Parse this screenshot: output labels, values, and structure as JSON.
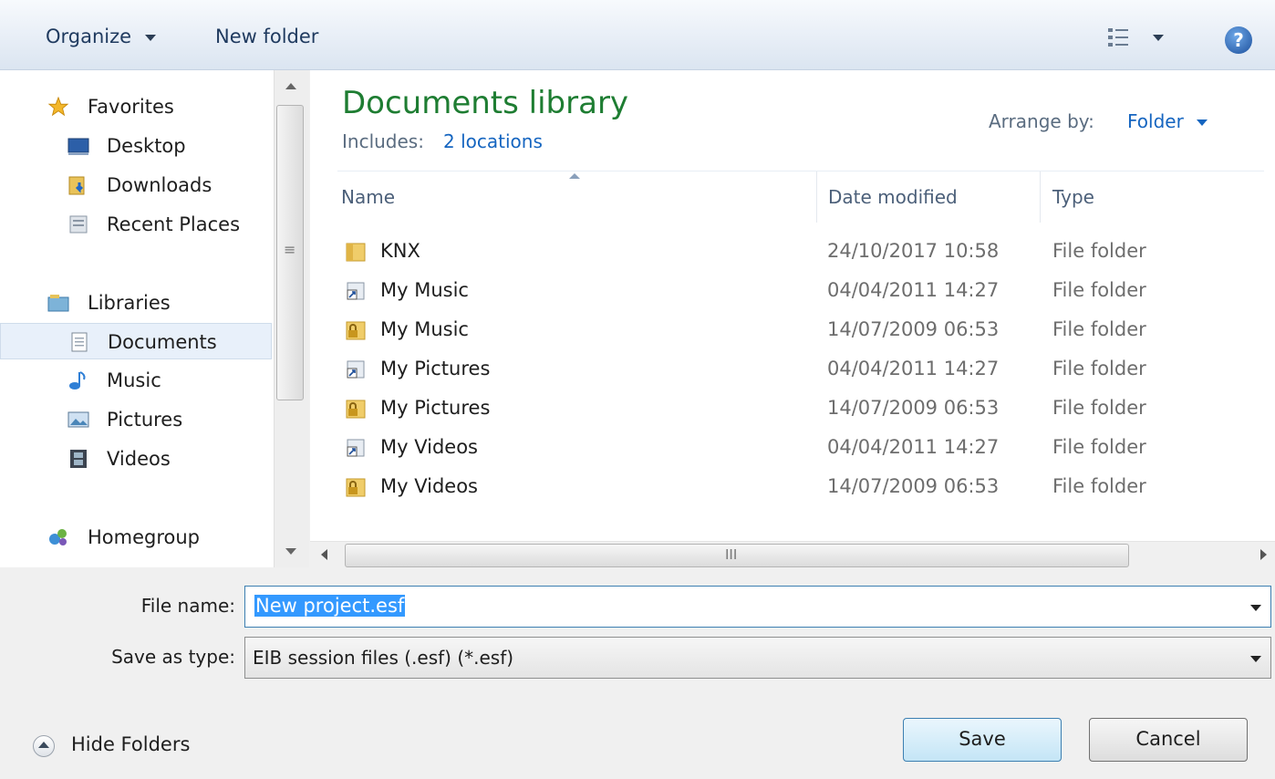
{
  "toolbar": {
    "organize_label": "Organize",
    "new_folder_label": "New folder",
    "view_icon": "details-view-icon",
    "help_icon": "help-icon"
  },
  "nav": {
    "favorites": "Favorites",
    "desktop": "Desktop",
    "downloads": "Downloads",
    "recent_places": "Recent Places",
    "libraries": "Libraries",
    "documents": "Documents",
    "music": "Music",
    "pictures": "Pictures",
    "videos": "Videos",
    "homegroup": "Homegroup"
  },
  "library": {
    "title": "Documents library",
    "includes_label": "Includes:",
    "includes_link": "2 locations",
    "arrange_label": "Arrange by:",
    "arrange_value": "Folder"
  },
  "columns": {
    "name": "Name",
    "date": "Date modified",
    "type": "Type"
  },
  "files": [
    {
      "name": "KNX",
      "date": "24/10/2017 10:58",
      "type": "File folder",
      "icon": "folder-icon"
    },
    {
      "name": "My Music",
      "date": "04/04/2011 14:27",
      "type": "File folder",
      "icon": "shortcut-icon"
    },
    {
      "name": "My Music",
      "date": "14/07/2009 06:53",
      "type": "File folder",
      "icon": "locked-folder-icon"
    },
    {
      "name": "My Pictures",
      "date": "04/04/2011 14:27",
      "type": "File folder",
      "icon": "shortcut-icon"
    },
    {
      "name": "My Pictures",
      "date": "14/07/2009 06:53",
      "type": "File folder",
      "icon": "locked-folder-icon"
    },
    {
      "name": "My Videos",
      "date": "04/04/2011 14:27",
      "type": "File folder",
      "icon": "shortcut-icon"
    },
    {
      "name": "My Videos",
      "date": "14/07/2009 06:53",
      "type": "File folder",
      "icon": "locked-folder-icon"
    }
  ],
  "hscroll_grip": "III",
  "nav_scroll_grip": "≡",
  "form": {
    "file_name_label": "File name:",
    "file_name_value": "New project.esf",
    "save_type_label": "Save as type:",
    "save_type_value": "EIB session files (.esf) (*.esf)"
  },
  "footer": {
    "hide_folders": "Hide Folders",
    "save": "Save",
    "cancel": "Cancel"
  },
  "colors": {
    "title_green": "#1e7d32",
    "link_blue": "#1565c0",
    "selection_blue": "#3399ff"
  }
}
